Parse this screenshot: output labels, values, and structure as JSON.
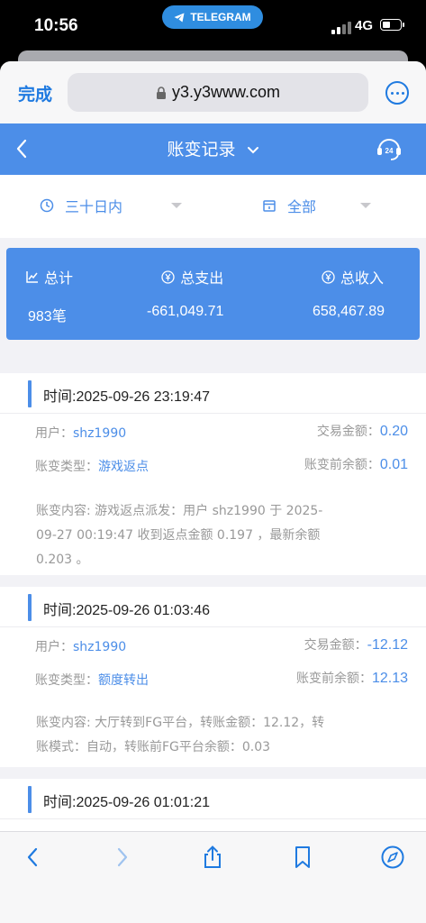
{
  "status": {
    "time": "10:56",
    "app_pill": "TELEGRAM",
    "network": "4G"
  },
  "browser": {
    "done_label": "完成",
    "url": "y3.y3www.com"
  },
  "header": {
    "title": "账变记录"
  },
  "filters": {
    "range": "三十日内",
    "type": "全部"
  },
  "summary": {
    "total_label": "总计",
    "total_value": "983笔",
    "expense_label": "总支出",
    "expense_value": "-661,049.71",
    "income_label": "总收入",
    "income_value": "658,467.89"
  },
  "records": [
    {
      "time": "时间:2025-09-26 23:19:47",
      "user_label": "用户：",
      "user": "shz1990",
      "amount_label": "交易金额：",
      "amount": "0.20",
      "type_label": "账变类型：",
      "type": "游戏返点",
      "before_label": "账变前余额：",
      "before": "0.01",
      "content_line1": "账变内容: 游戏返点派发：用户 shz1990 于 2025-",
      "content_line2": "09-27 00:19:47 收到返点金额 0.197 ，最新余额",
      "content_line3": "0.203 。"
    },
    {
      "time": "时间:2025-09-26 01:03:46",
      "user_label": "用户：",
      "user": "shz1990",
      "amount_label": "交易金额：",
      "amount": "-12.12",
      "type_label": "账变类型：",
      "type": "额度转出",
      "before_label": "账变前余额：",
      "before": "12.13",
      "content_line1": "账变内容: 大厅转到FG平台，转账金额：12.12，转",
      "content_line2": "账模式：自动，转账前FG平台余额：0.03"
    },
    {
      "time": "时间:2025-09-26 01:01:21"
    }
  ],
  "colors": {
    "accent": "#4c8ee8",
    "ios_blue": "#1f7ae0"
  },
  "icons": [
    "back-icon",
    "forward-icon",
    "share-icon",
    "bookmarks-icon",
    "compass-icon",
    "support-24-icon",
    "clock-icon",
    "calendar-icon",
    "chart-icon",
    "yen-icon"
  ]
}
